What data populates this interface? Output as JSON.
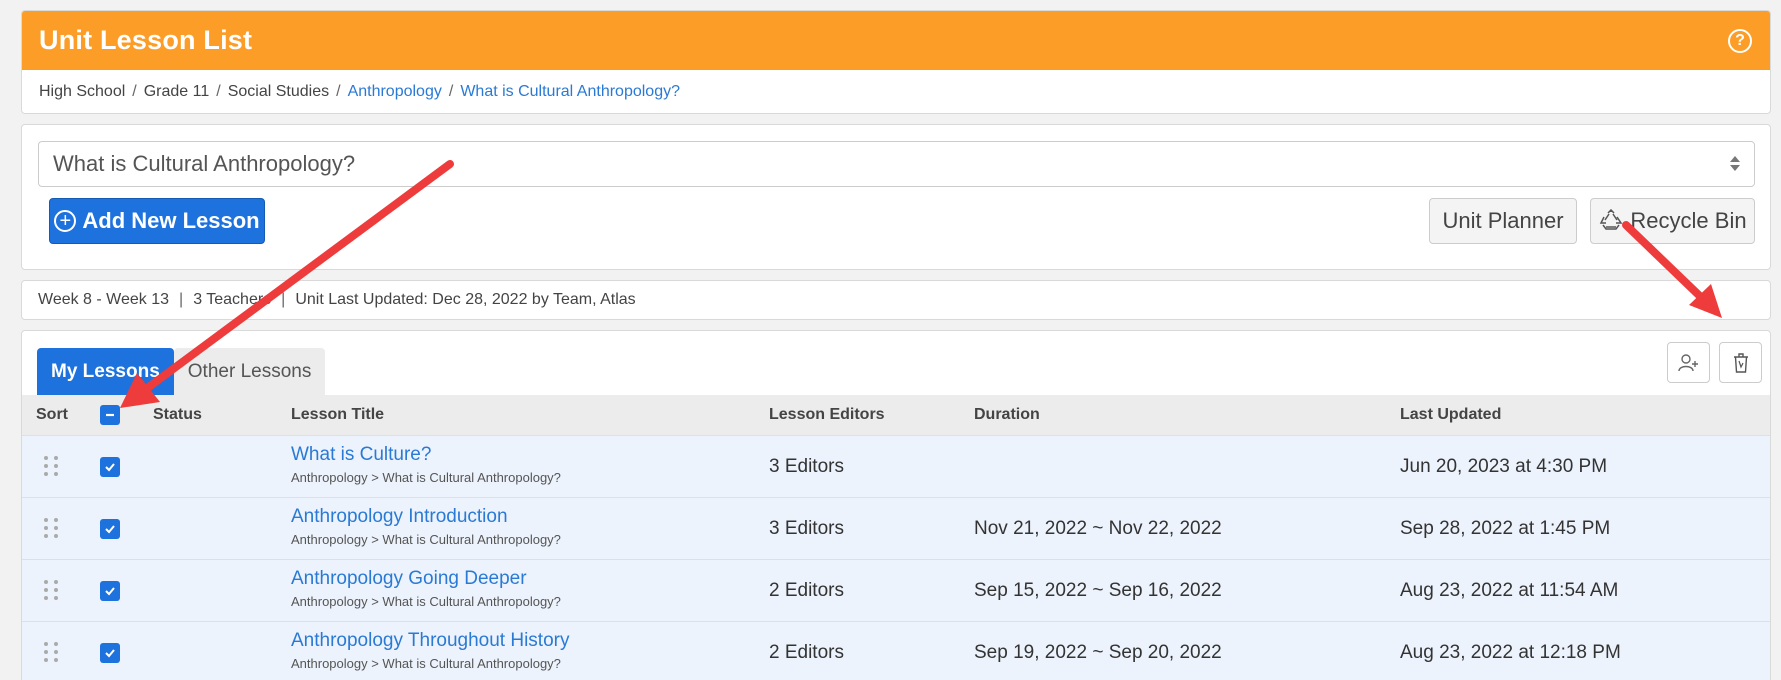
{
  "header": {
    "title": "Unit Lesson List",
    "help_icon": "?"
  },
  "breadcrumb": [
    {
      "label": "High School",
      "link": false
    },
    {
      "label": "Grade 11",
      "link": false
    },
    {
      "label": "Social Studies",
      "link": false
    },
    {
      "label": "Anthropology",
      "link": true
    },
    {
      "label": "What is Cultural Anthropology?",
      "link": true
    }
  ],
  "breadcrumb_sep": "/",
  "unit_select": {
    "value": "What is Cultural Anthropology?"
  },
  "toolbar": {
    "add_label": "Add New Lesson",
    "unit_planner_label": "Unit Planner",
    "recycle_bin_label": "Recycle Bin"
  },
  "info": {
    "weeks": "Week 8 - Week 13",
    "teachers": "3 Teachers",
    "updated": "Unit Last Updated: Dec 28, 2022 by Team, Atlas",
    "sep": "|"
  },
  "tabs": [
    {
      "label": "My Lessons",
      "active": true
    },
    {
      "label": "Other Lessons",
      "active": false
    }
  ],
  "columns": {
    "sort": "Sort",
    "status": "Status",
    "title": "Lesson Title",
    "editors": "Lesson Editors",
    "duration": "Duration",
    "updated": "Last Updated"
  },
  "rows": [
    {
      "title": "What is Culture?",
      "path": "Anthropology > What is Cultural Anthropology?",
      "editors": "3 Editors",
      "duration": "",
      "updated": "Jun 20, 2023 at 4:30 PM",
      "checked": true
    },
    {
      "title": "Anthropology Introduction",
      "path": "Anthropology > What is Cultural Anthropology?",
      "editors": "3 Editors",
      "duration": "Nov 21, 2022 ~ Nov 22, 2022",
      "updated": "Sep 28, 2022 at 1:45 PM",
      "checked": true
    },
    {
      "title": "Anthropology Going Deeper",
      "path": "Anthropology > What is Cultural Anthropology?",
      "editors": "2 Editors",
      "duration": "Sep 15, 2022 ~ Sep 16, 2022",
      "updated": "Aug 23, 2022 at 11:54 AM",
      "checked": true
    },
    {
      "title": "Anthropology Throughout History",
      "path": "Anthropology > What is Cultural Anthropology?",
      "editors": "2 Editors",
      "duration": "Sep 19, 2022 ~ Sep 20, 2022",
      "updated": "Aug 23, 2022 at 12:18 PM",
      "checked": true
    }
  ],
  "colors": {
    "header_orange": "#fc9d27",
    "primary_blue": "#1e72de",
    "link_blue": "#2a7ad5",
    "row_bg": "#ecf3fc",
    "arrow_red": "#ee3b3b"
  },
  "icons": {
    "help": "help-icon",
    "add": "plus-circle-icon",
    "recycle": "recycle-icon",
    "assign_editor": "user-plus-icon",
    "delete": "trash-icon",
    "drag": "drag-handle-icon",
    "checkbox": "checkmark-icon"
  }
}
